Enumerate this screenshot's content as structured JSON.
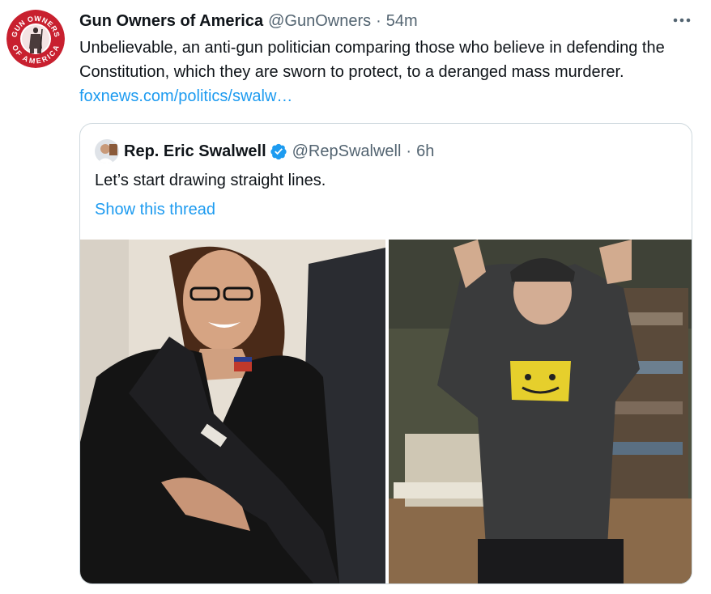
{
  "tweet": {
    "display_name": "Gun Owners of America",
    "handle": "@GunOwners",
    "separator": "·",
    "time": "54m",
    "text": "Unbelievable, an anti-gun politician comparing those who believe in defending the Constitution, which they are sworn to protect, to a deranged mass murderer. ",
    "link_text": "foxnews.com/politics/swalw…",
    "avatar_icon": "gun-owners-of-america-logo",
    "more_icon": "more-horizontal-icon"
  },
  "avatar_logo": {
    "top_text": "GUN OWNERS",
    "bottom_text": "OF AMERICA"
  },
  "quote": {
    "display_name": "Rep. Eric Swalwell",
    "verified_icon": "verified-badge-icon",
    "handle": "@RepSwalwell",
    "separator": "·",
    "time": "6h",
    "text": "Let’s start drawing straight lines.",
    "show_thread": "Show this thread"
  },
  "colors": {
    "link": "#1d9bf0",
    "secondary_text": "#536471",
    "border": "#cfd9de",
    "verified": "#1d9bf0",
    "logo_red": "#c8202f"
  }
}
